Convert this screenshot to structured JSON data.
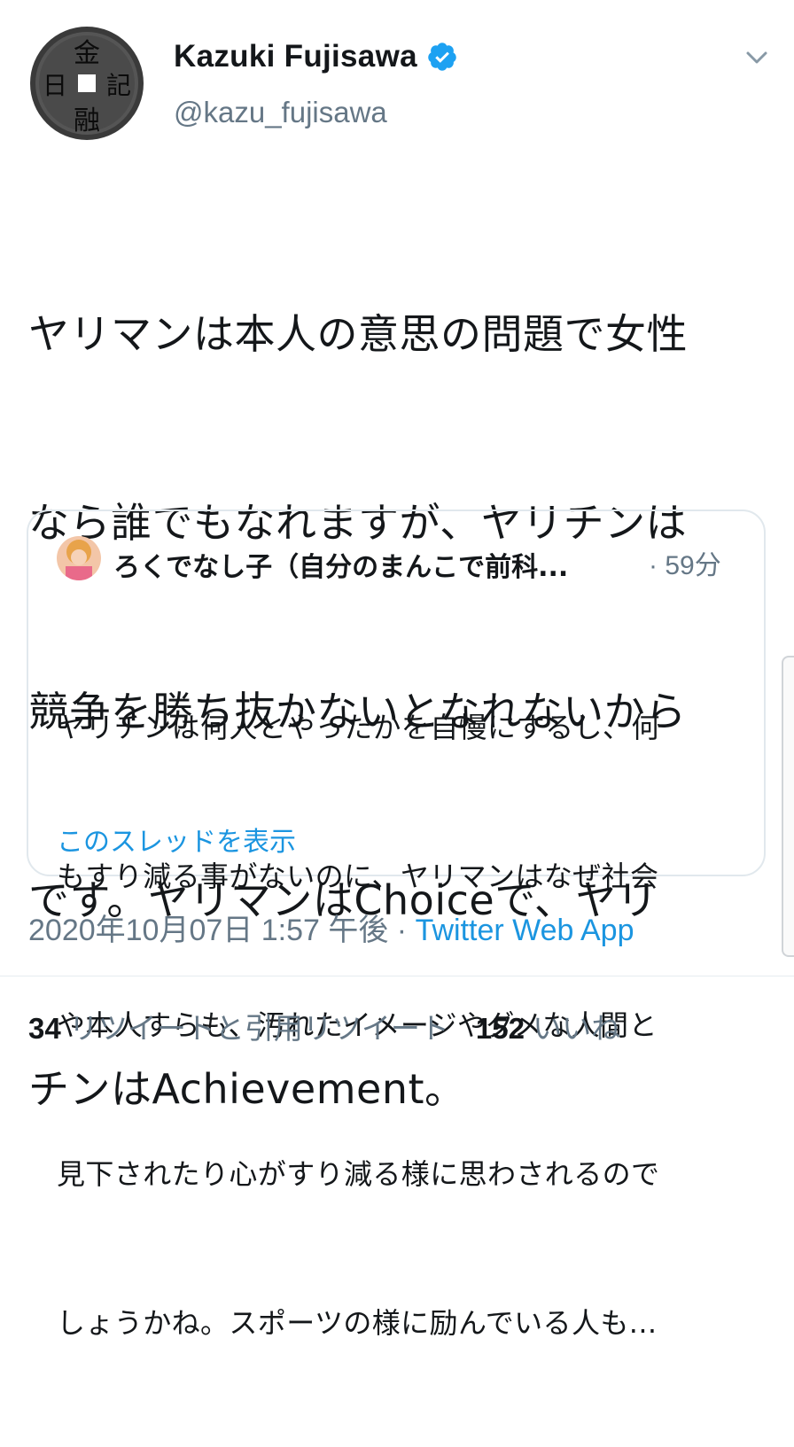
{
  "author": {
    "name": "Kazuki Fujisawa",
    "handle": "@kazu_fujisawa",
    "verified": true,
    "avatar_glyphs": [
      "金",
      "融",
      "日",
      "記"
    ]
  },
  "tweet": {
    "lines": [
      "ヤリマンは本人の意思の問題で女性",
      "なら誰でもなれますが、ヤリチンは",
      "競争を勝ち抜かないとなれないから",
      "です。ヤリマンはChoiceで、ヤリ",
      "チンはAchievement。"
    ]
  },
  "quoted": {
    "name": "ろくでなし子（自分のまんこで前科...",
    "time": "· 59分",
    "lines": [
      "ヤリチンは何人とやったかを自慢にするし、何",
      "もすり減る事がないのに、ヤリマンはなぜ社会",
      "や本人すらも、汚れたイメージやダメな人間と",
      "見下されたり心がすり減る様に思わされるので",
      "しょうかね。スポーツの様に励んでいる人も..."
    ],
    "show_thread": "このスレッドを表示"
  },
  "meta": {
    "timestamp": "2020年10月07日 1:57 午後 · ",
    "source": "Twitter Web App"
  },
  "stats": {
    "retweets_count": "34",
    "retweets_label": " リツイートと引用リツイート",
    "likes_count": "152",
    "likes_label": " いいね"
  },
  "colors": {
    "link": "#1b95e0",
    "secondary": "#657786",
    "verified": "#1da1f2",
    "border": "#e1e8ed"
  }
}
